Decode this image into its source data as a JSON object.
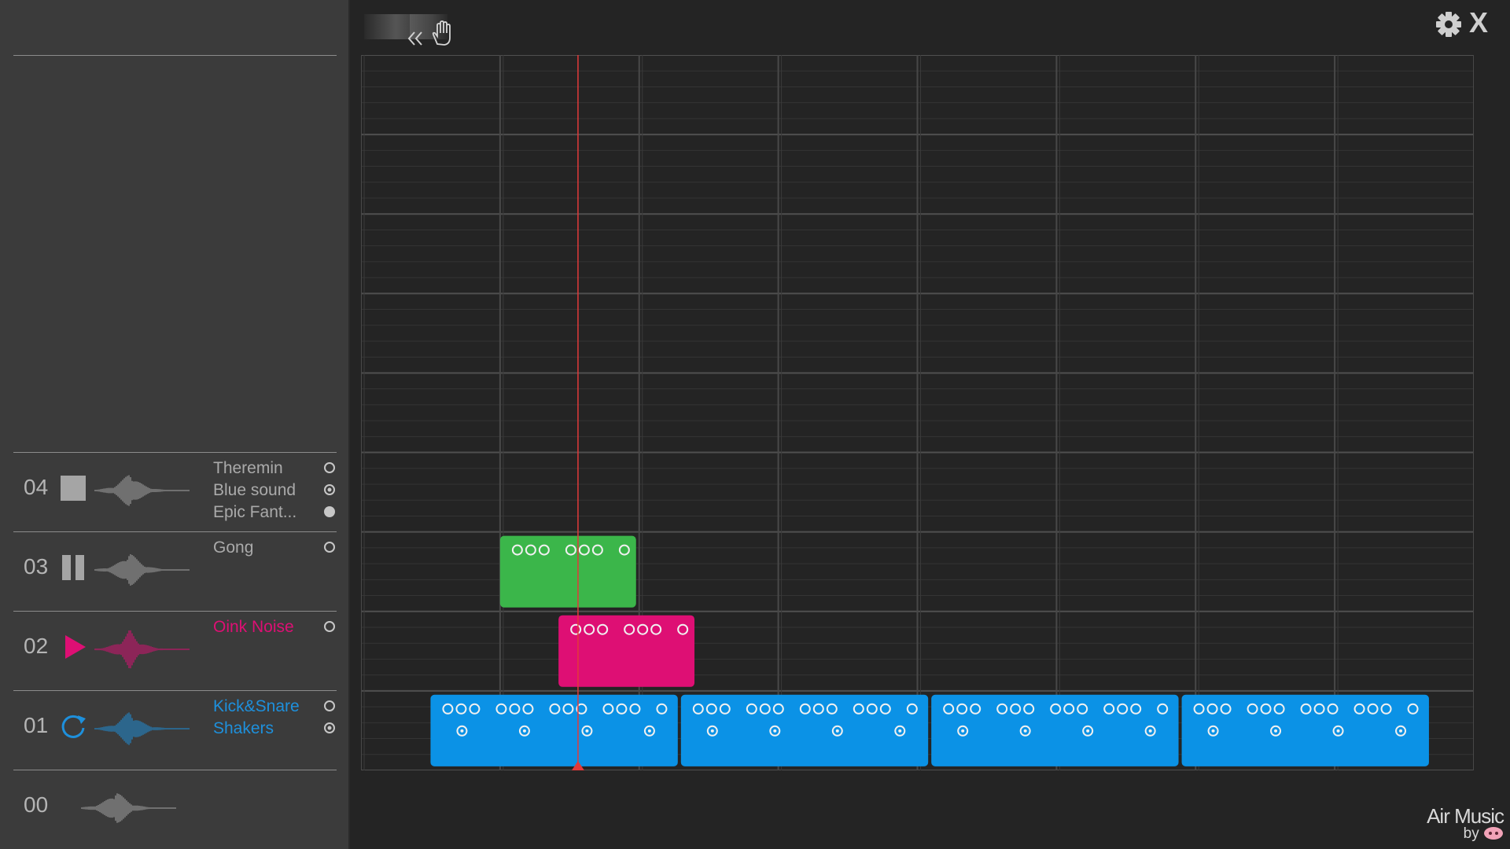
{
  "tracks": [
    {
      "num": "04",
      "control": "stop",
      "color": "#a5a5a5",
      "instruments": [
        {
          "label": "Theremin",
          "radio": "empty"
        },
        {
          "label": "Blue sound",
          "radio": "target"
        },
        {
          "label": "Epic Fant...",
          "radio": "filled"
        }
      ]
    },
    {
      "num": "03",
      "control": "pause",
      "color": "#a5a5a5",
      "instruments": [
        {
          "label": "Gong",
          "radio": "empty"
        }
      ]
    },
    {
      "num": "02",
      "control": "play",
      "color": "#de0f74",
      "instruments": [
        {
          "label": "Oink Noise",
          "radio": "empty"
        }
      ]
    },
    {
      "num": "01",
      "control": "loop",
      "color": "#1e90dc",
      "instruments": [
        {
          "label": "Kick&Snare",
          "radio": "empty"
        },
        {
          "label": "Shakers",
          "radio": "target"
        }
      ]
    },
    {
      "num": "00",
      "control": "none",
      "color": "#a5a5a5",
      "instruments": []
    }
  ],
  "toolbar": {
    "icons": [
      "collapse-icon",
      "hand-icon"
    ]
  },
  "header_icons": {
    "settings": "gear-icon",
    "close": "close-icon",
    "close_label": "X"
  },
  "clips": [
    {
      "track": "03",
      "color": "#3bb64a",
      "start_step": 1,
      "length": 1,
      "row1": "oo oo  oo ooo"
    },
    {
      "track": "02",
      "color": "#de0f74",
      "start_step": 1.42,
      "length": 1,
      "row1": "oo oooo oo ooo"
    },
    {
      "track": "01",
      "color": "#0b92e6",
      "start_step": 0.5,
      "length": 1.8
    },
    {
      "track": "01",
      "color": "#0b92e6",
      "start_step": 2.3,
      "length": 1.8
    },
    {
      "track": "01",
      "color": "#0b92e6",
      "start_step": 4.1,
      "length": 1.8
    },
    {
      "track": "01",
      "color": "#0b92e6",
      "start_step": 5.9,
      "length": 1.8
    }
  ],
  "playhead": {
    "position_step": 1.56,
    "color": "#e23a3a"
  },
  "logo": {
    "title": "Air Music",
    "by": "by"
  }
}
